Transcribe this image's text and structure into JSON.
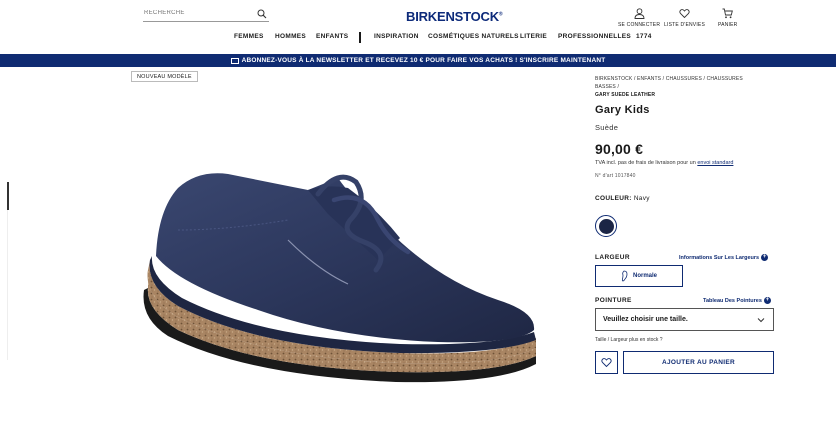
{
  "header": {
    "search": {
      "placeholder": "RECHERCHE"
    },
    "logo": "BIRKENSTOCK",
    "logo_mark": "®",
    "account_label": "SE CONNECTER",
    "wishlist_label": "LISTE D'ENVIES",
    "cart_label": "PANIER"
  },
  "nav": {
    "items": [
      "FEMMES",
      "HOMMES",
      "ENFANTS",
      "INSPIRATION",
      "COSMÉTIQUES NATURELS",
      "LITERIE",
      "PROFESSIONNELLES",
      "1774"
    ]
  },
  "banner": {
    "text": "ABONNEZ-VOUS À LA NEWSLETTER ET RECEVEZ 10 € POUR FAIRE VOS ACHATS !",
    "cta": "S'INSCRIRE MAINTENANT"
  },
  "product": {
    "badge": "NOUVEAU MODÈLE",
    "breadcrumb": [
      "BIRKENSTOCK",
      "ENFANTS",
      "CHAUSSURES",
      "CHAUSSURES BASSES"
    ],
    "breadcrumb_current": "GARY SUEDE LEATHER",
    "title": "Gary Kids",
    "subtitle": "Suède",
    "price": "90,00 €",
    "tax_note": "TVA incl. pas de frais de livraison pour un",
    "tax_link": "envoi standard",
    "art_no": "N° d'art 1017840",
    "color_label": "COULEUR:",
    "color_value": "Navy",
    "color_hex": "#1b2545",
    "width_label": "LARGEUR",
    "width_info": "Informations Sur Les Largeurs",
    "width_option": "Normale",
    "size_label": "POINTURE",
    "size_info": "Tableau Des Pointures",
    "size_select": "Veuillez choisir une taille.",
    "stock_note": "Taille / Largeur plus en stock ?",
    "add_to_cart": "AJOUTER AU PANIER"
  },
  "colors": {
    "brand": "#0f2b72",
    "banner_bg": "#0f2b72"
  }
}
